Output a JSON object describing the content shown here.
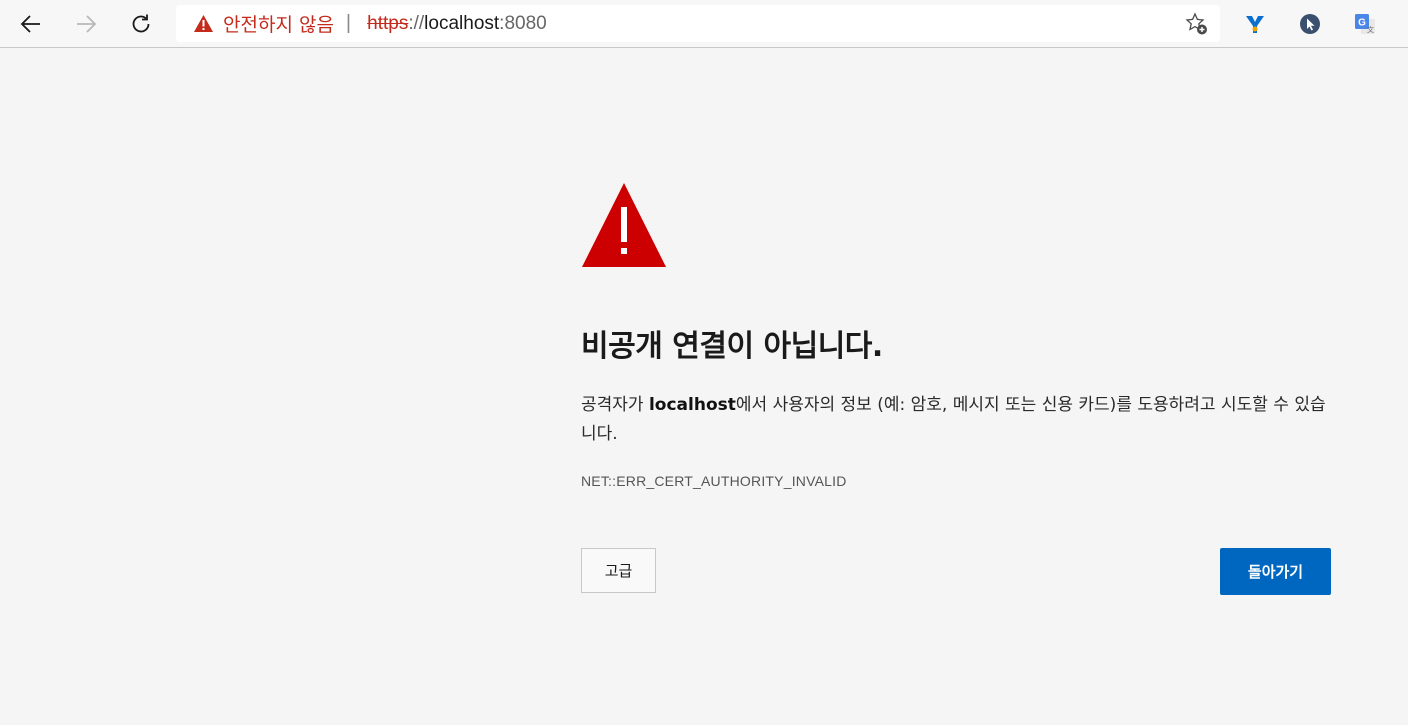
{
  "toolbar": {
    "back_icon": "arrow-left-icon",
    "forward_icon": "arrow-right-icon",
    "refresh_icon": "refresh-icon",
    "address": {
      "security_label": "안전하지 않음",
      "separator": "|",
      "url_scheme": "https",
      "url_separator": "://",
      "url_host": "localhost",
      "url_port": ":8080"
    },
    "favorite_icon": "star-add-icon",
    "extensions": [
      {
        "icon": "y-shield-extension-icon",
        "color": "#0a6fd1"
      },
      {
        "icon": "cursor-extension-icon",
        "color": "#3b4f6e"
      },
      {
        "icon": "google-translate-extension-icon",
        "color": "#4a86e8"
      }
    ]
  },
  "error_page": {
    "icon": "warning-triangle-icon",
    "title": "비공개 연결이 아닙니다.",
    "description_prefix": "공격자가 ",
    "description_host": "localhost",
    "description_suffix": "에서 사용자의 정보 (예: 암호, 메시지 또는 신용 카드)를 도용하려고 시도할 수 있습니다.",
    "error_code": "NET::ERR_CERT_AUTHORITY_INVALID",
    "advanced_button": "고급",
    "back_button": "돌아가기"
  },
  "colors": {
    "warning_red": "#c42b1c",
    "triangle_red": "#cc0000",
    "primary_button": "#0067c0",
    "page_background": "#f5f5f5"
  }
}
